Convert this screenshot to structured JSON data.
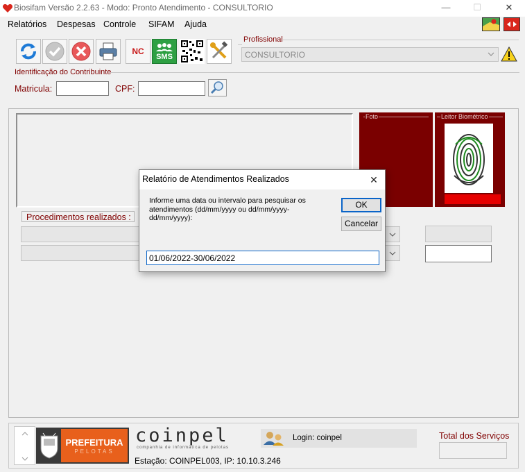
{
  "window": {
    "title": "Biosifam Versão 2.2.63 - Modo: Pronto Atendimento - CONSULTORIO",
    "minimize": "—",
    "maximize": "☐",
    "close": "✕"
  },
  "menu": [
    "Relatórios",
    "Despesas",
    "Controle",
    "SIFAM",
    "Ajuda"
  ],
  "toolbar": {
    "nc_label": "NC",
    "sms_label": "SMS"
  },
  "profissional": {
    "label": "Profissional",
    "value": "CONSULTORIO"
  },
  "contribuinte": {
    "label": "Identificação do Contribuinte",
    "matricula_label": "Matricula:",
    "matricula_value": "",
    "cpf_label": "CPF:",
    "cpf_value": ""
  },
  "panels": {
    "foto_label": "Foto",
    "leitor_label": "Leitor Biométrico",
    "procedimentos_label": "Procedimentos realizados :"
  },
  "dialog": {
    "title": "Relatório de Atendimentos Realizados",
    "message": "Informe uma data ou intervalo para pesquisar os atendimentos (dd/mm/yyyy ou dd/mm/yyyy-dd/mm/yyyy):",
    "ok_label": "OK",
    "cancel_label": "Cancelar",
    "input_value": "01/06/2022-30/06/2022",
    "close": "✕"
  },
  "footer": {
    "prefeitura_line1": "PREFEITURA",
    "prefeitura_line2": "PELOTAS",
    "coinpel_logo": "coinpel",
    "coinpel_tagline": "companhia de informática de pelotas",
    "login_text": "Login: coinpel",
    "estacao_text": "Estação: COINPEL003, IP: 10.10.3.246",
    "total_label": "Total dos Serviços",
    "total_value": ""
  },
  "colors": {
    "accent_red": "#800000",
    "panel_red": "#7a0000",
    "prefeitura_orange": "#e8601c"
  }
}
